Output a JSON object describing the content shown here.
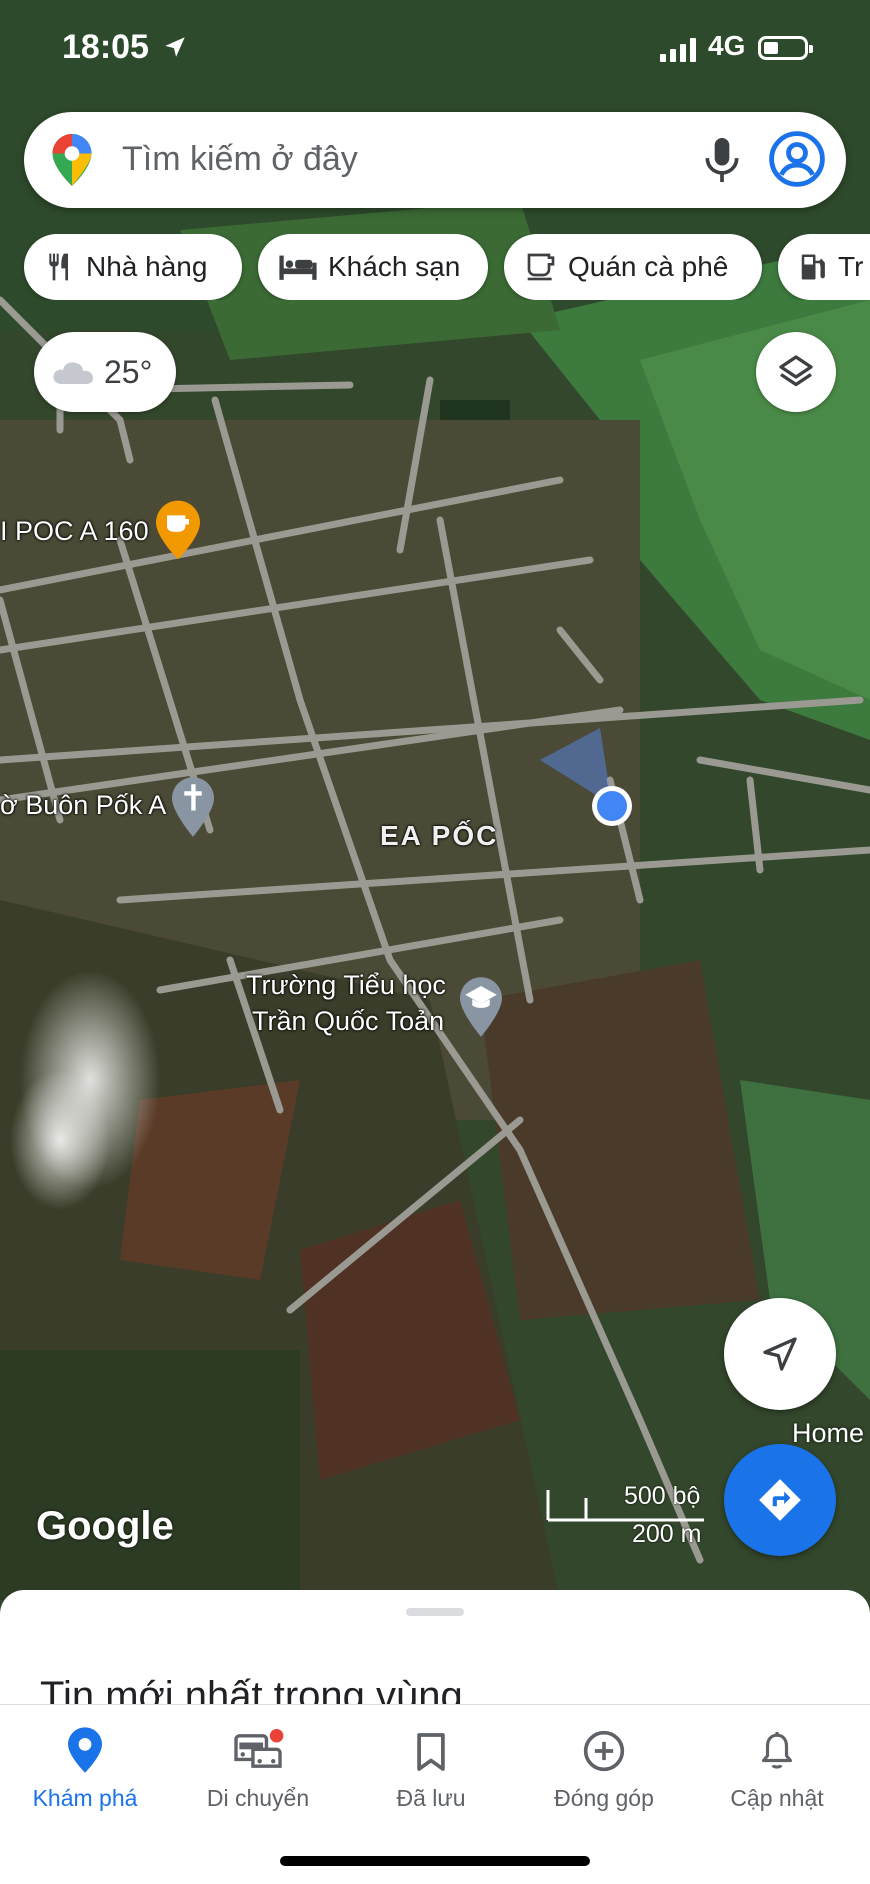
{
  "status_bar": {
    "time": "18:05",
    "network": "4G"
  },
  "search": {
    "placeholder": "Tìm kiếm ở đây"
  },
  "chips": [
    {
      "label": "Nhà hàng",
      "icon": "restaurant-icon"
    },
    {
      "label": "Khách sạn",
      "icon": "hotel-icon"
    },
    {
      "label": "Quán cà phê",
      "icon": "coffee-icon"
    },
    {
      "label": "Tr",
      "icon": "gas-station-icon"
    }
  ],
  "weather": {
    "temperature": "25°",
    "icon": "cloud-icon"
  },
  "map_labels": {
    "cafe": "I POC A 160",
    "church": "ờ Buôn Pốk A",
    "area": "EA PỐC",
    "school_line1": "Trường Tiểu học",
    "school_line2": "Trần Quốc Toản",
    "home": "Home"
  },
  "attribution": "Google",
  "scale": {
    "imperial": "500 bộ",
    "metric": "200 m"
  },
  "sheet": {
    "title": "Tin mới nhất trong vùng"
  },
  "nav": [
    {
      "label": "Khám phá",
      "icon": "explore-pin-icon",
      "active": true
    },
    {
      "label": "Di chuyển",
      "icon": "commute-icon",
      "active": false
    },
    {
      "label": "Đã lưu",
      "icon": "bookmark-icon",
      "active": false
    },
    {
      "label": "Đóng góp",
      "icon": "add-circle-icon",
      "active": false
    },
    {
      "label": "Cập nhật",
      "icon": "bell-icon",
      "active": false
    }
  ],
  "colors": {
    "accent": "#1a73e8",
    "notification_dot": "#ea4335",
    "cafe_pin": "#f29900"
  }
}
